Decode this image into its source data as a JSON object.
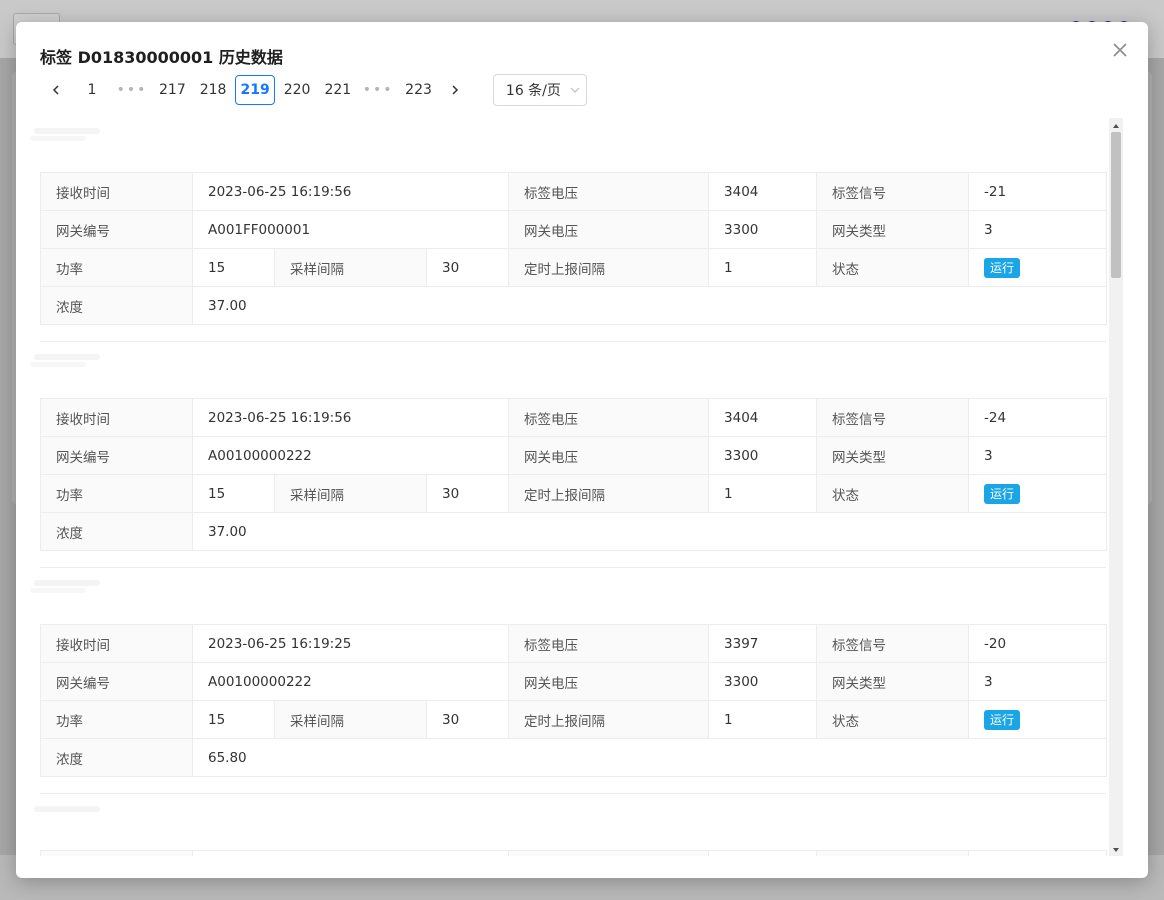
{
  "modal": {
    "title": "标签 D01830000001 历史数据"
  },
  "pagination": {
    "pages": [
      "1",
      "217",
      "218",
      "219",
      "220",
      "221",
      "223"
    ],
    "ellipsis": "•••",
    "current": "219",
    "page_size": "16 条/页"
  },
  "labels": {
    "receive_time": "接收时间",
    "tag_voltage": "标签电压",
    "tag_signal": "标签信号",
    "gateway_id": "网关编号",
    "gateway_voltage": "网关电压",
    "gateway_type": "网关类型",
    "power": "功率",
    "sample_interval": "采样间隔",
    "report_interval": "定时上报间隔",
    "status": "状态",
    "concentration": "浓度"
  },
  "records": [
    {
      "receive_time": "2023-06-25 16:19:56",
      "tag_voltage": "3404",
      "tag_signal": "-21",
      "gateway_id": "A001FF000001",
      "gateway_voltage": "3300",
      "gateway_type": "3",
      "power": "15",
      "sample_interval": "30",
      "report_interval": "1",
      "status": "运行",
      "concentration": "37.00"
    },
    {
      "receive_time": "2023-06-25 16:19:56",
      "tag_voltage": "3404",
      "tag_signal": "-24",
      "gateway_id": "A00100000222",
      "gateway_voltage": "3300",
      "gateway_type": "3",
      "power": "15",
      "sample_interval": "30",
      "report_interval": "1",
      "status": "运行",
      "concentration": "37.00"
    },
    {
      "receive_time": "2023-06-25 16:19:25",
      "tag_voltage": "3397",
      "tag_signal": "-20",
      "gateway_id": "A00100000222",
      "gateway_voltage": "3300",
      "gateway_type": "3",
      "power": "15",
      "sample_interval": "30",
      "report_interval": "1",
      "status": "运行",
      "concentration": "65.80"
    }
  ],
  "colors": {
    "accent": "#1677ff",
    "status_tag": "#1aa6e6"
  },
  "icons": {
    "close": "close-icon",
    "prev": "chevron-left-icon",
    "next": "chevron-right-icon",
    "dropdown": "chevron-down-icon"
  }
}
